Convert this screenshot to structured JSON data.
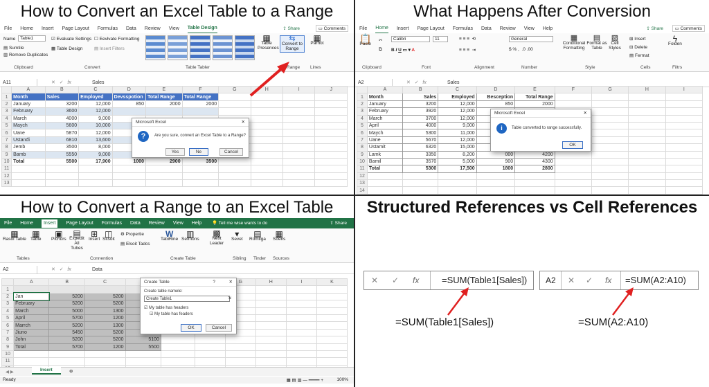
{
  "q1": {
    "title": "How to Convert an Excel Table to a Range",
    "tabs": [
      "File",
      "Home",
      "Insert",
      "Page Layout",
      "Formulas",
      "Data",
      "Review",
      "View",
      "Table Design"
    ],
    "share": "Share",
    "comments": "Comments",
    "props": {
      "name_label": "Name",
      "name_value": "Table1",
      "summarize": "Sumtile",
      "remove_dup": "Remove Duplicates",
      "evaluate": "Evaluate Settings",
      "table_design": "Table Design",
      "evaluate_fmt": "Eevlvate Formatting",
      "insert_filters": "Insert Filters",
      "table_presences": "Table Presences",
      "convert_range": "Convert to Range",
      "parnot": "Parnot"
    },
    "groups": {
      "clipboard": "Clipboard",
      "convert": "Convert",
      "table_tabler": "Table Tabler",
      "range": "Range",
      "lines": "Lines"
    },
    "cell_ref": "A11",
    "formula": "Sales",
    "cols": [
      "A",
      "B",
      "C",
      "D",
      "E",
      "F",
      "G",
      "H",
      "I",
      "J"
    ],
    "rows": [
      [
        "Month",
        "Sales",
        "Employed",
        "Devsspotion",
        "Total Range",
        "Total Range"
      ],
      [
        "January",
        "3200",
        "12,000",
        "850",
        "2000",
        "2000"
      ],
      [
        "February",
        "3600",
        "12,000",
        "",
        "",
        ""
      ],
      [
        "March",
        "4000",
        "9,000",
        "",
        "",
        ""
      ],
      [
        "Maych",
        "5600",
        "10,000",
        "",
        "",
        ""
      ],
      [
        "Uane",
        "5870",
        "12,000",
        "",
        "",
        ""
      ],
      [
        "Ustanđi",
        "6810",
        "13,600",
        "",
        "",
        ""
      ],
      [
        "Jemb",
        "3500",
        "8,000",
        "",
        "",
        ""
      ],
      [
        "Bamb",
        "5550",
        "9,000",
        "900",
        "4500",
        "4500"
      ],
      [
        "Total",
        "5500",
        "17,900",
        "1000",
        "2900",
        "3500"
      ],
      [
        "",
        "",
        "",
        "",
        "",
        ""
      ],
      [
        "",
        "",
        "",
        "",
        "",
        ""
      ],
      [
        "",
        "",
        "",
        "",
        "",
        ""
      ]
    ],
    "dialog": {
      "title": "Microsoft Excel",
      "message": "Are you sure, convert an Excel Table to a Range?",
      "yes": "Yes",
      "no": "Ne",
      "cancel": "Cancel"
    }
  },
  "q2": {
    "title": "What Happens After Conversion",
    "tabs": [
      "File",
      "Home",
      "Insert",
      "Page Layout",
      "Formulas",
      "Data",
      "Review",
      "View",
      "Help"
    ],
    "share": "Share",
    "comments": "Comments",
    "ribbon": {
      "paste": "Paste",
      "font_name": "Calibri",
      "font_size": "11",
      "number_format": "General",
      "cond_fmt": "Conditional Formatting",
      "format_table": "Format as Table",
      "cell_styles": "Cell Styles",
      "insert": "Insert",
      "delete": "Delete",
      "format": "Fermat",
      "folden": "Folden"
    },
    "groups": {
      "clipboard": "Clipboard",
      "font": "Font",
      "alignment": "Alignment",
      "number": "Number",
      "style": "Style",
      "cells": "Cells",
      "editing": "Filtrs"
    },
    "cell_ref": "A2",
    "formula": "Sales",
    "cols": [
      "A",
      "B",
      "C",
      "D",
      "E",
      "F",
      "G",
      "H",
      "I"
    ],
    "rows": [
      [
        "Month",
        "Sales",
        "Employed",
        "Besception",
        "Total Range"
      ],
      [
        "January",
        "3200",
        "12,000",
        "850",
        "2000"
      ],
      [
        "February",
        "3920",
        "12,000",
        "",
        ""
      ],
      [
        "March",
        "3700",
        "12,000",
        "",
        ""
      ],
      [
        "April",
        "4000",
        "9,000",
        "",
        ""
      ],
      [
        "Maych",
        "5300",
        "11,000",
        "",
        ""
      ],
      [
        "Uane",
        "5670",
        "12,000",
        "",
        ""
      ],
      [
        "Ustamit",
        "6320",
        "15,000",
        "",
        ""
      ],
      [
        "Lamk",
        "3350",
        "8,200",
        "000",
        "4200"
      ],
      [
        "Bamil",
        "3570",
        "5,000",
        "900",
        "4300"
      ],
      [
        "Total",
        "5300",
        "17,500",
        "1800",
        "2800"
      ],
      [
        "",
        "",
        "",
        "",
        ""
      ],
      [
        "",
        "",
        "",
        "",
        ""
      ],
      [
        "",
        "",
        "",
        "",
        ""
      ]
    ],
    "dialog": {
      "title": "Microsoft Excel",
      "message": "Table converted to range successfully.",
      "ok": "OK"
    }
  },
  "q3": {
    "title": "How to Convert a Range to an Excel Table",
    "tabs": [
      "File",
      "Home",
      "Insert",
      "Page Layout",
      "Formulas",
      "Data",
      "Review",
      "View",
      "Help"
    ],
    "tell": "Tell me wise wants to do",
    "share": "Share",
    "ribbon": {
      "pivot": "Rasoi Table",
      "table": "Table",
      "pictures": "Pichurs",
      "expedit": "Expedit All Tubes",
      "insert": "Insert",
      "shapes": "Sitsoit",
      "properties": "Propertie",
      "elsoit": "Elsoit Tadcs",
      "tablitine": "TabiRine",
      "sermons": "Sefmons",
      "next": "Next Leader",
      "sevet": "Sevet",
      "romliga": "Romliga",
      "sources": "Soens"
    },
    "groups": {
      "tables": "Tables",
      "connection": "Connention",
      "create_table": "Create Table",
      "sibling": "Sibling",
      "tinder": "Tinder",
      "sources": "Sources"
    },
    "cell_ref": "A2",
    "formula": "Data",
    "cols": [
      "A",
      "B",
      "C",
      "D",
      "E",
      "F",
      "G",
      "H",
      "I",
      "K"
    ],
    "rows": [
      [
        "",
        "",
        "",
        ""
      ],
      [
        "Jan",
        "5200",
        "5200",
        "5300"
      ],
      [
        "February",
        "5200",
        "5200",
        "5300"
      ],
      [
        "March",
        "5000",
        "1300",
        "5200"
      ],
      [
        "April",
        "5700",
        "1200",
        "5400"
      ],
      [
        "Marrch",
        "5200",
        "1300",
        "5400"
      ],
      [
        "Jiuno",
        "5450",
        "5200",
        "5400"
      ],
      [
        "John",
        "5200",
        "5200",
        "5100"
      ],
      [
        "Total",
        "5700",
        "1200",
        "5500"
      ],
      [
        "",
        "",
        "",
        ""
      ],
      [
        "",
        "",
        "",
        ""
      ],
      [
        "",
        "",
        "",
        ""
      ]
    ],
    "dialog": {
      "title": "Create Table",
      "help": "?",
      "label": "Create table namele:",
      "value": "Create Table1",
      "chk1": "My table has headers",
      "chk2": "My table has feaders",
      "ok": "OK",
      "cancel": "Cancel"
    },
    "sheet_tab": "Insert",
    "status": "Ready",
    "zoom": "100%"
  },
  "q4": {
    "title": "Structured References vs Cell References",
    "left": {
      "formula": "=SUM(Table1[Sales])",
      "caption": "=SUM(Table1[Sales])"
    },
    "right": {
      "cell_ref": "A2",
      "formula": "=SUM(A2:A10)",
      "caption": "=SUM(A2:A10)"
    },
    "x_icon": "✕",
    "check_icon": "✓",
    "fx_label": "fx"
  },
  "colors": {
    "excel_green": "#217346",
    "header_blue": "#4472c4",
    "band_blue": "#dce6f1",
    "arrow_red": "#e02020"
  }
}
